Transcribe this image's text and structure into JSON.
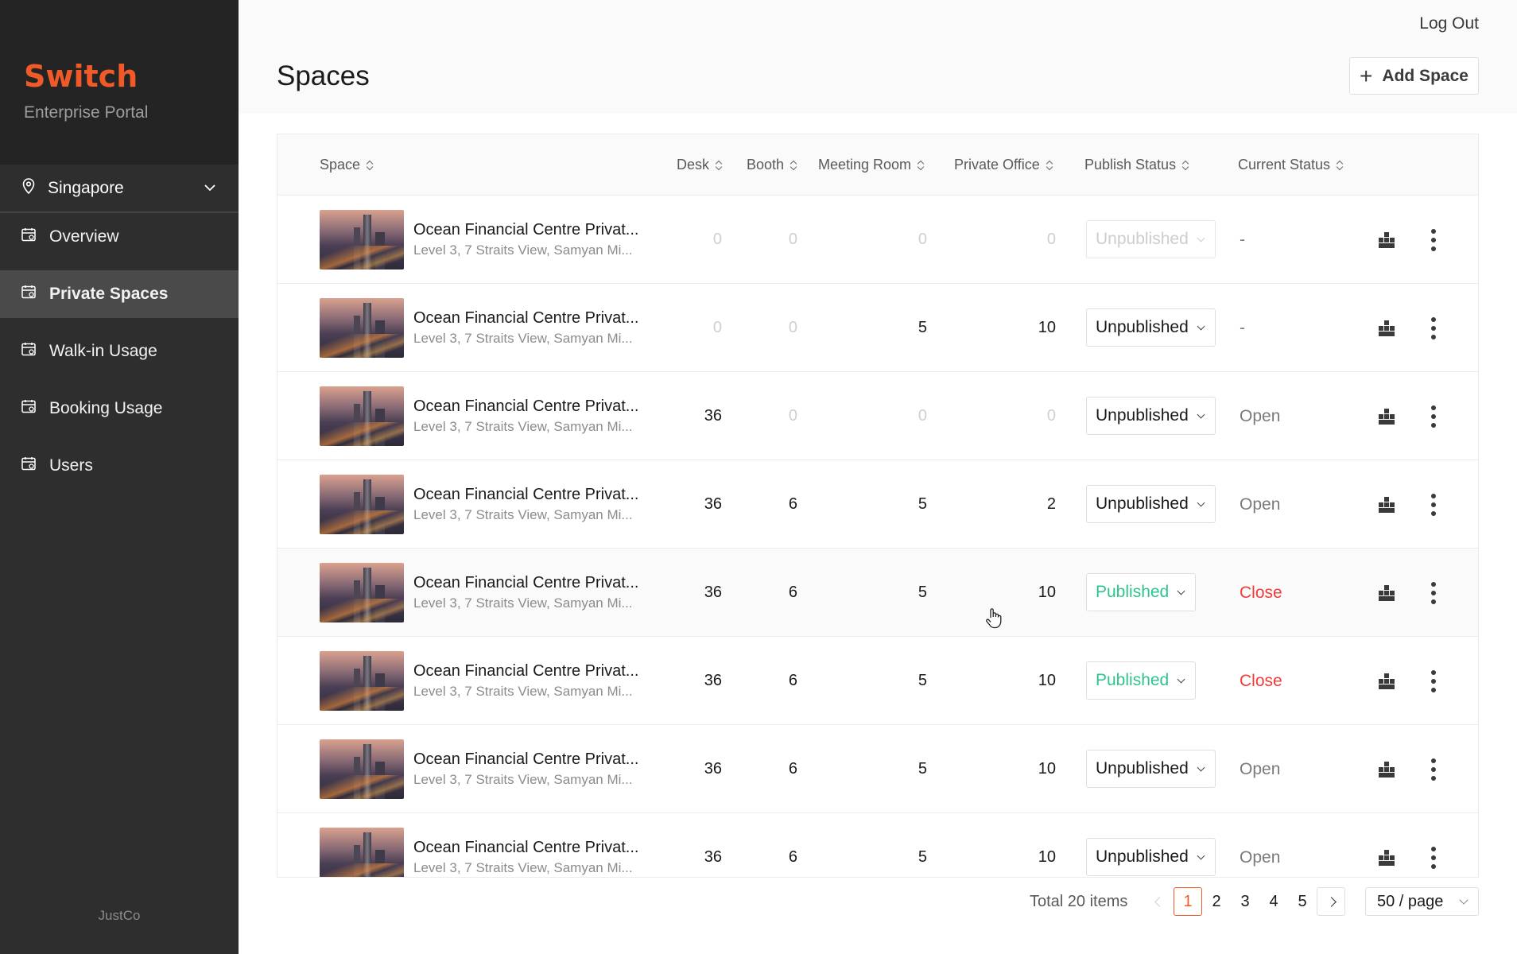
{
  "sidebar": {
    "logo": "Switch",
    "subtitle": "Enterprise Portal",
    "location": "Singapore",
    "items": [
      {
        "label": "Overview",
        "active": false
      },
      {
        "label": "Private Spaces",
        "active": true
      },
      {
        "label": "Walk-in Usage",
        "active": false
      },
      {
        "label": "Booking Usage",
        "active": false
      },
      {
        "label": "Users",
        "active": false
      }
    ],
    "footer": "JustCo"
  },
  "header": {
    "logout": "Log Out",
    "title": "Spaces",
    "add_button": "Add Space"
  },
  "table": {
    "columns": [
      "Space",
      "Desk",
      "Booth",
      "Meeting Room",
      "Private Office",
      "Publish Status",
      "Current Status"
    ],
    "rows": [
      {
        "name": "Ocean Financial Centre Privat...",
        "address": "Level 3, 7 Straits View, Samyan Mi...",
        "desk": "0",
        "booth": "0",
        "meeting": "0",
        "office": "0",
        "publish": "Unpublished",
        "publish_state": "disabled",
        "current": "-"
      },
      {
        "name": "Ocean Financial Centre Privat...",
        "address": "Level 3, 7 Straits View, Samyan Mi...",
        "desk": "0",
        "booth": "0",
        "meeting": "5",
        "office": "10",
        "publish": "Unpublished",
        "publish_state": "normal",
        "current": "-"
      },
      {
        "name": "Ocean Financial Centre Privat...",
        "address": "Level 3, 7 Straits View, Samyan Mi...",
        "desk": "36",
        "booth": "0",
        "meeting": "0",
        "office": "0",
        "publish": "Unpublished",
        "publish_state": "normal",
        "current": "Open"
      },
      {
        "name": "Ocean Financial Centre Privat...",
        "address": "Level 3, 7 Straits View, Samyan Mi...",
        "desk": "36",
        "booth": "6",
        "meeting": "5",
        "office": "2",
        "publish": "Unpublished",
        "publish_state": "normal",
        "current": "Open"
      },
      {
        "name": "Ocean Financial Centre Privat...",
        "address": "Level 3, 7 Straits View, Samyan Mi...",
        "desk": "36",
        "booth": "6",
        "meeting": "5",
        "office": "10",
        "publish": "Published",
        "publish_state": "published",
        "current": "Close"
      },
      {
        "name": "Ocean Financial Centre Privat...",
        "address": "Level 3, 7 Straits View, Samyan Mi...",
        "desk": "36",
        "booth": "6",
        "meeting": "5",
        "office": "10",
        "publish": "Published",
        "publish_state": "published",
        "current": "Close"
      },
      {
        "name": "Ocean Financial Centre Privat...",
        "address": "Level 3, 7 Straits View, Samyan Mi...",
        "desk": "36",
        "booth": "6",
        "meeting": "5",
        "office": "10",
        "publish": "Unpublished",
        "publish_state": "normal",
        "current": "Open"
      },
      {
        "name": "Ocean Financial Centre Privat...",
        "address": "Level 3, 7 Straits View, Samyan Mi...",
        "desk": "36",
        "booth": "6",
        "meeting": "5",
        "office": "10",
        "publish": "Unpublished",
        "publish_state": "normal",
        "current": "Open"
      }
    ]
  },
  "pagination": {
    "total": "Total 20 items",
    "pages": [
      "1",
      "2",
      "3",
      "4",
      "5"
    ],
    "current_page": "1",
    "page_size": "50 / page"
  },
  "colors": {
    "brand": "#f05a28",
    "published": "#2fc48d",
    "close": "#f23b3b",
    "sidebar": "#2e2e2e"
  }
}
